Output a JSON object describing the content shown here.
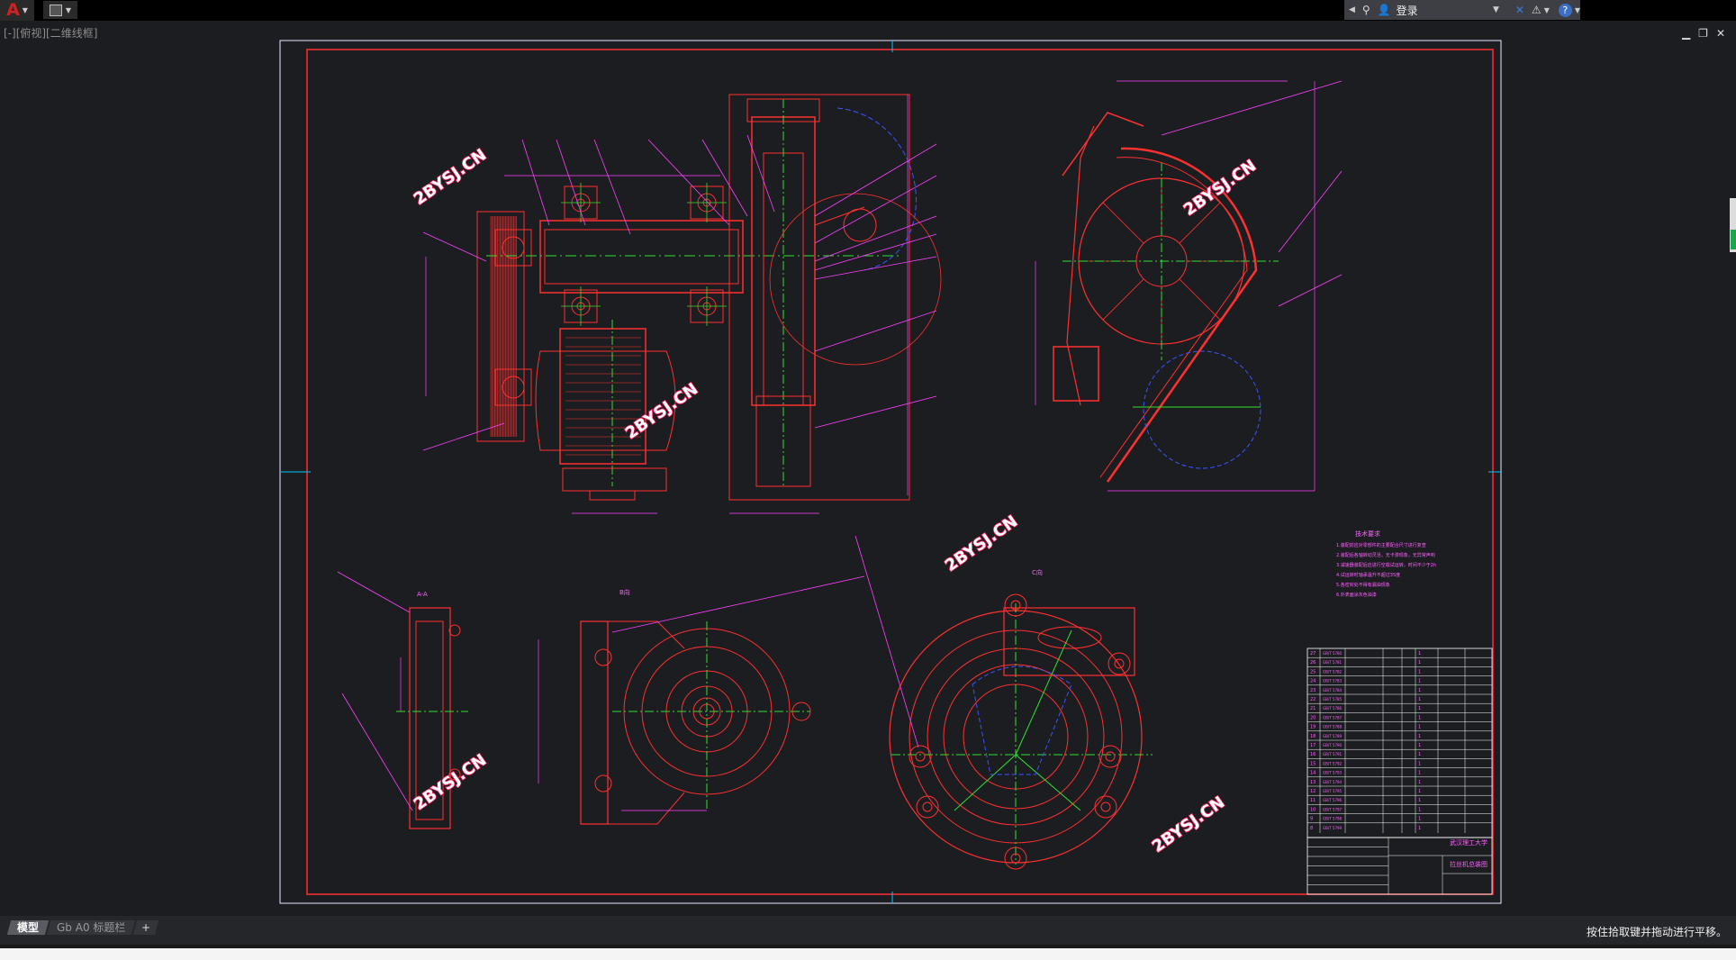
{
  "window": {
    "viewport_label": "[-][俯视][二维线框]",
    "infocenter": {
      "login_label": "登录"
    },
    "window_controls": {
      "minimize": "▁",
      "restore": "❐",
      "close": "✕"
    }
  },
  "drawing": {
    "watermark": "2BYSJ.CN",
    "title_block_school": "武汉理工大学",
    "title_block_name": "拉丝机总装图",
    "tech_requirements_title": "技术要求",
    "tech_requirements": [
      "1.装配前应对零部件的主要配合尺寸进行复查",
      "2.装配后各轴转动灵活，无卡滞现象，无异常声响",
      "3.减速器装配后应进行空载试运转，时间不少于2h",
      "4.试运转时轴承温升不超过35度",
      "5.各密封处不得有漏油现象",
      "6.外表面涂灰色油漆"
    ],
    "section_aa": "A-A",
    "view_b": "B向",
    "view_c": "C向"
  },
  "layout_tabs": [
    "模型",
    "Gb A0 标题栏"
  ],
  "status_message": "按住拾取键并拖动进行平移。",
  "colors": {
    "background": "#1c1d21",
    "frame": "#ff3030",
    "leader": "#ff40ff",
    "centerline": "#30e030",
    "hidden": "#3a55ff",
    "watermark_fill": "#ffffff",
    "watermark_stroke": "#ff2060"
  }
}
